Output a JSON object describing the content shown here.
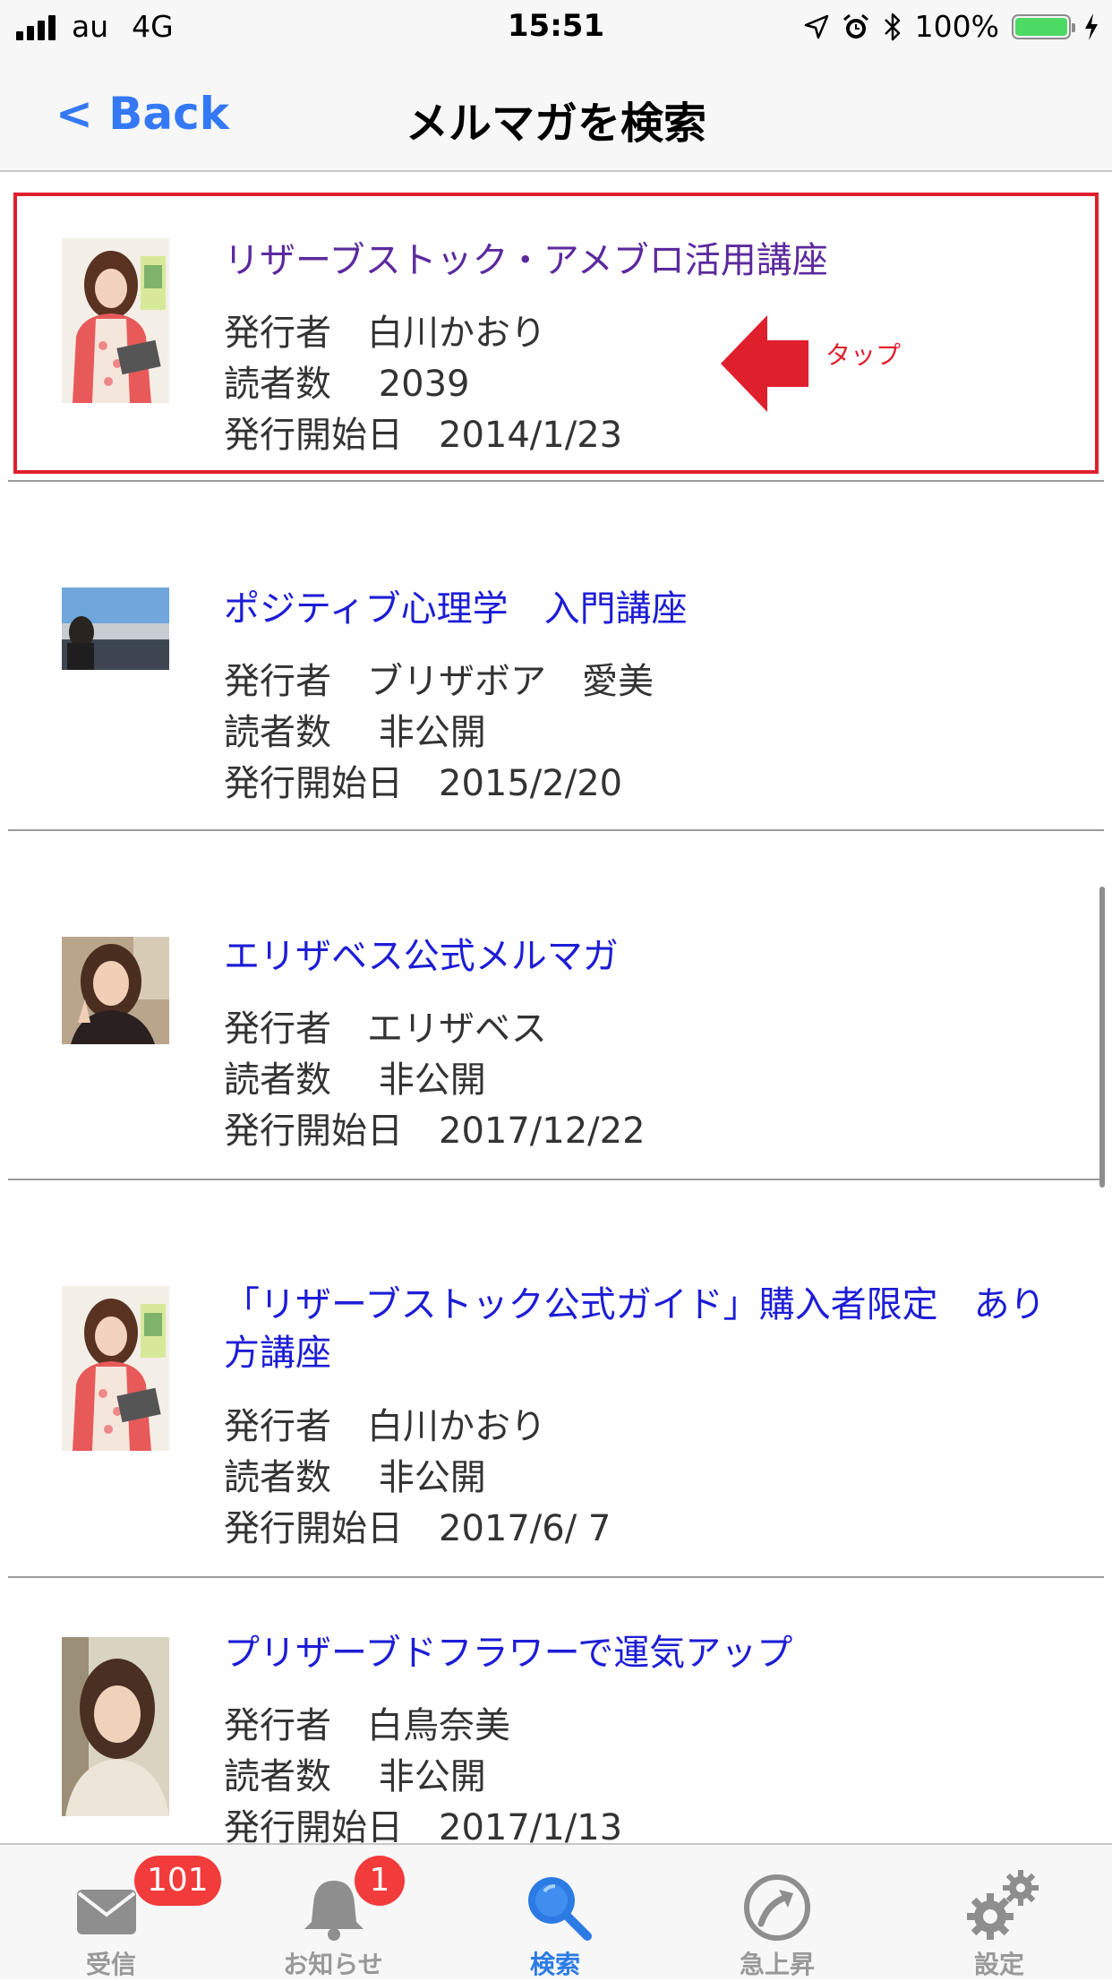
{
  "status_bar": {
    "carrier": "au",
    "network": "4G",
    "time": "15:51",
    "battery": "100%"
  },
  "nav": {
    "back_label": "< Back",
    "title": "メルマガを検索"
  },
  "annotation": {
    "tap_label": "タップ",
    "color": "#e01f2d"
  },
  "items": [
    {
      "title": "リザーブストック・アメブロ活用講座",
      "publisher": "発行者　白川かおり",
      "readers": "読者数　 2039",
      "start_date": "発行開始日　2014/1/23",
      "visited": true
    },
    {
      "title": "ポジティブ心理学　入門講座",
      "publisher": "発行者　ブリザボア　愛美",
      "readers": "読者数　 非公開",
      "start_date": "発行開始日　2015/2/20"
    },
    {
      "title": "エリザベス公式メルマガ",
      "publisher": "発行者　エリザベス",
      "readers": "読者数　 非公開",
      "start_date": "発行開始日　2017/12/22"
    },
    {
      "title": "「リザーブストック公式ガイド」購入者限定　あり方講座",
      "publisher": "発行者　白川かおり",
      "readers": "読者数　 非公開",
      "start_date": "発行開始日　2017/6/ 7"
    },
    {
      "title": "プリザーブドフラワーで運気アップ",
      "publisher": "発行者　白鳥奈美",
      "readers": "読者数　 非公開",
      "start_date": "発行開始日　2017/1/13"
    }
  ],
  "tabs": [
    {
      "label": "受信",
      "icon": "mail-icon",
      "badge": "101"
    },
    {
      "label": "お知らせ",
      "icon": "bell-icon",
      "badge": "1"
    },
    {
      "label": "検索",
      "icon": "search-icon",
      "active": true
    },
    {
      "label": "急上昇",
      "icon": "trending-arrow-icon"
    },
    {
      "label": "設定",
      "icon": "gear-icon"
    }
  ],
  "colors": {
    "link": "#1d1dd6",
    "visited_link": "#5c2a9e",
    "accent": "#3478f6",
    "badge": "#f23b3b",
    "active_tab": "#2c7be5"
  }
}
